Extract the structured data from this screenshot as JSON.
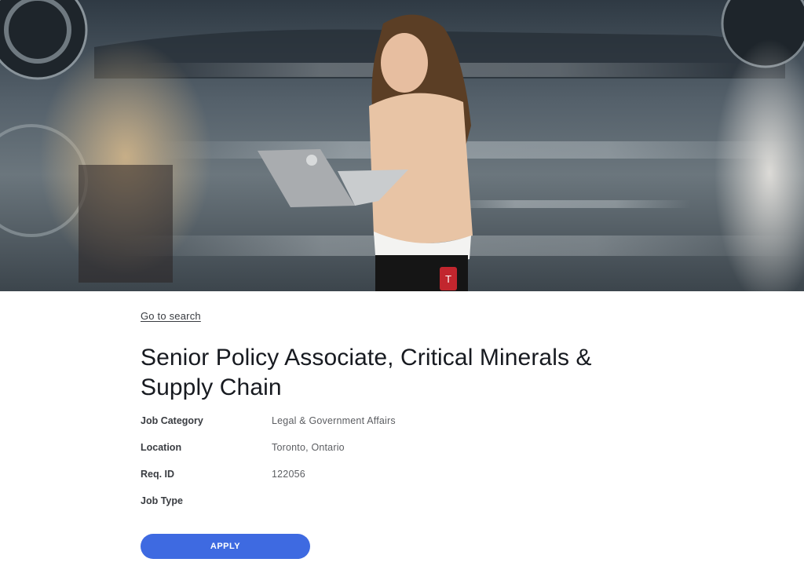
{
  "hero": {
    "image_alt": "",
    "badge_logo": "tesla-logo"
  },
  "navigation": {
    "back_link": "Go to search"
  },
  "job": {
    "title": "Senior Policy Associate, Critical Minerals & Supply Chain",
    "details": [
      {
        "label": "Job Category",
        "value": "Legal & Government Affairs"
      },
      {
        "label": "Location",
        "value": "Toronto, Ontario"
      },
      {
        "label": "Req. ID",
        "value": "122056"
      },
      {
        "label": "Job Type",
        "value": ""
      }
    ]
  },
  "actions": {
    "apply_label": "APPLY"
  },
  "colors": {
    "accent": "#3e6ae1",
    "text_primary": "#171a20",
    "text_secondary": "#5c5e62",
    "background": "#ffffff"
  }
}
